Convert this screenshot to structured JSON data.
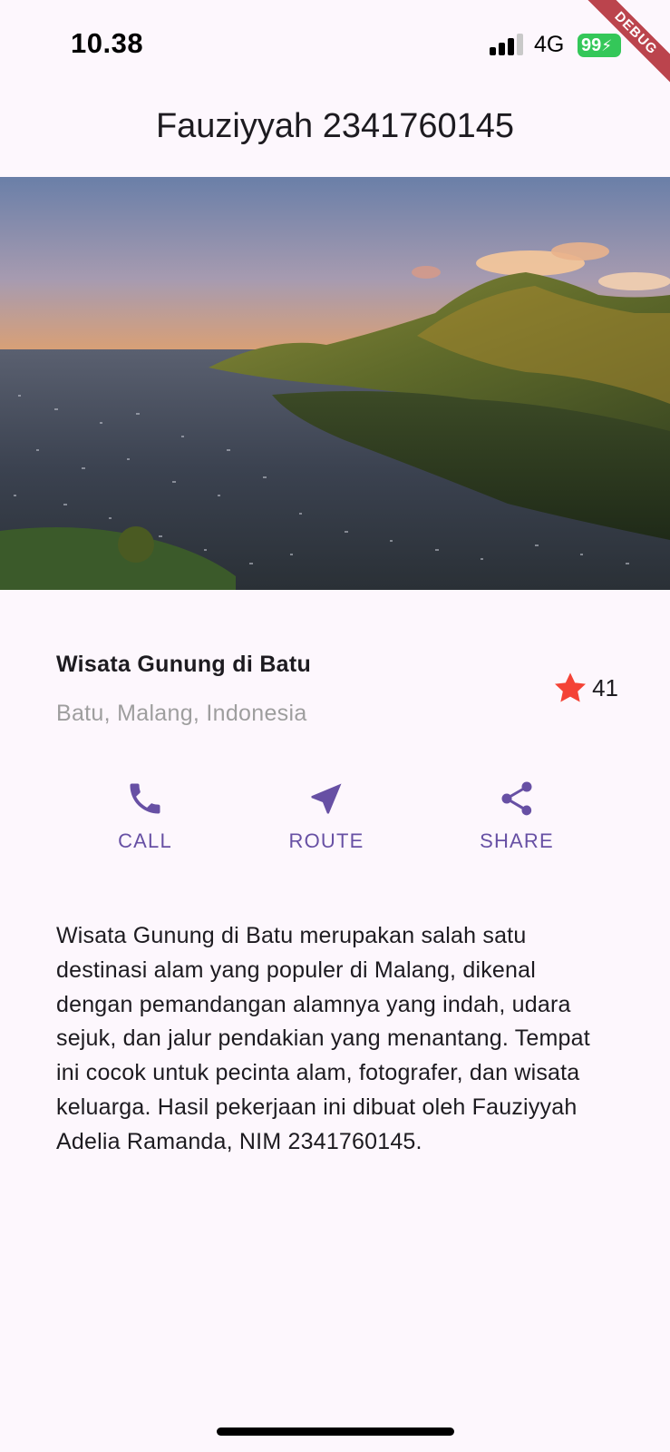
{
  "status_bar": {
    "time": "10.38",
    "network": "4G",
    "battery": "99"
  },
  "debug_banner": "DEBUG",
  "app_bar": {
    "title": "Fauziyyah 2341760145"
  },
  "hero": {
    "icon": "mountain-landscape-photo"
  },
  "title_section": {
    "name": "Wisata Gunung di Batu",
    "location": "Batu, Malang, Indonesia",
    "rating": "41",
    "star_color": "#f44336"
  },
  "buttons": [
    {
      "label": "CALL",
      "icon": "phone-icon"
    },
    {
      "label": "ROUTE",
      "icon": "near-me-icon"
    },
    {
      "label": "SHARE",
      "icon": "share-icon"
    }
  ],
  "accent_color": "#6750a4",
  "description": "Wisata Gunung di Batu merupakan salah satu destinasi alam yang populer di Malang, dikenal dengan pemandangan alamnya yang indah, udara sejuk, dan jalur pendakian yang menantang. Tempat ini cocok untuk pecinta alam, fotografer, dan wisata keluarga. Hasil pekerjaan ini dibuat oleh Fauziyyah Adelia Ramanda, NIM 2341760145."
}
